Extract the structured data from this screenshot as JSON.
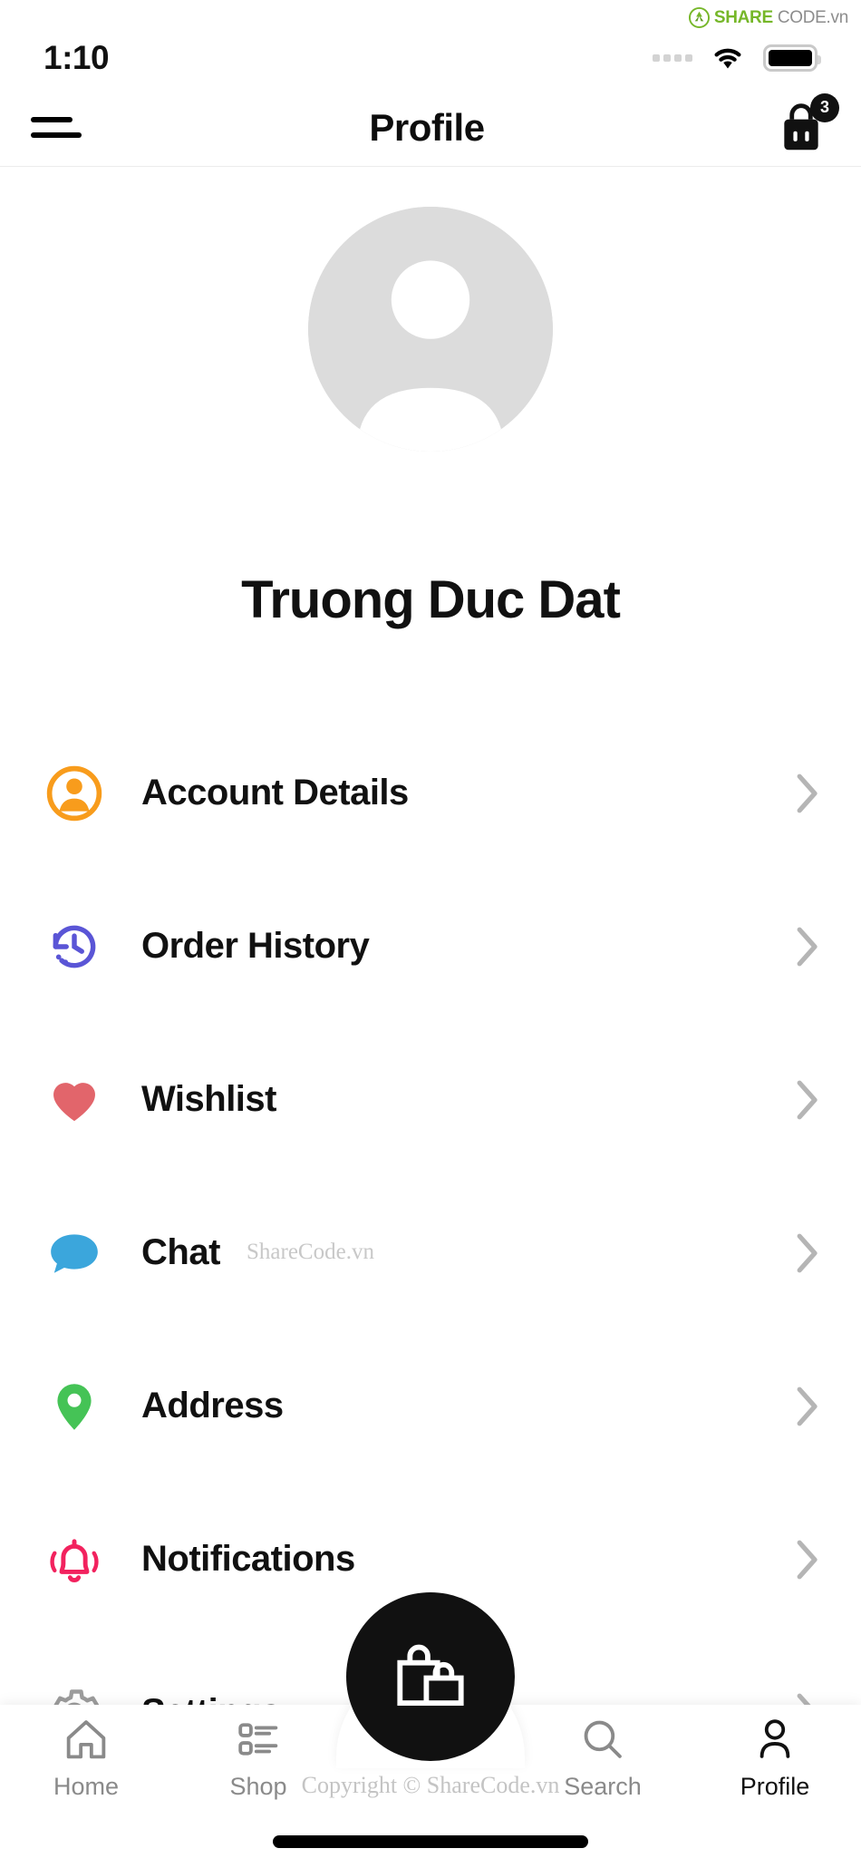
{
  "watermark": {
    "brand_share": "SHARE",
    "brand_code": "CODE.vn",
    "mid_text": "ShareCode.vn",
    "bottom_text": "Copyright © ShareCode.vn"
  },
  "status_bar": {
    "time": "1:10",
    "signal_icon": "signal-dots-icon",
    "wifi_icon": "wifi-icon",
    "battery_icon": "battery-full-icon"
  },
  "header": {
    "menu_icon": "hamburger-menu-icon",
    "title": "Profile",
    "cart_icon": "shopping-bag-icon",
    "cart_count": "3"
  },
  "profile": {
    "avatar_icon": "avatar-placeholder-icon",
    "name": "Truong Duc Dat"
  },
  "menu": {
    "items": [
      {
        "label": "Account Details",
        "icon": "account-circle-icon",
        "color": "#f89c1c"
      },
      {
        "label": "Order History",
        "icon": "history-clock-icon",
        "color": "#5a55d6"
      },
      {
        "label": "Wishlist",
        "icon": "heart-icon",
        "color": "#e2656b"
      },
      {
        "label": "Chat",
        "icon": "chat-bubble-icon",
        "color": "#3ba6dc"
      },
      {
        "label": "Address",
        "icon": "map-pin-icon",
        "color": "#45c356"
      },
      {
        "label": "Notifications",
        "icon": "bell-ring-icon",
        "color": "#f2225e"
      },
      {
        "label": "Settings",
        "icon": "gear-icon",
        "color": "#9c9c9c"
      }
    ],
    "chevron_icon": "chevron-right-icon"
  },
  "bottom_nav": {
    "items": [
      {
        "label": "Home",
        "icon": "home-icon",
        "active": false
      },
      {
        "label": "Shop",
        "icon": "list-icon",
        "active": false
      },
      {
        "label": "Search",
        "icon": "search-icon",
        "active": false
      },
      {
        "label": "Profile",
        "icon": "person-icon",
        "active": true
      }
    ],
    "fab_icon": "shopping-bags-icon"
  }
}
